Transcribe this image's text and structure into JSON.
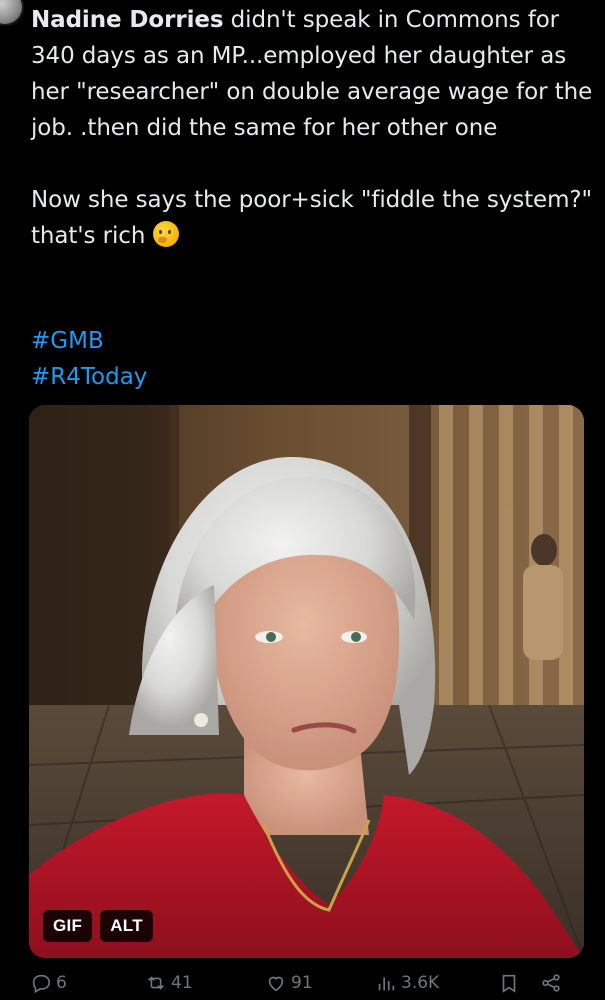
{
  "tweet": {
    "author": "Nadine Dorries",
    "para1_rest": " didn't speak in Commons for 340 days as an MP...employed her daughter as her \"researcher\" on double average wage for the job. .then did the same for her other one",
    "para2": "Now she says the poor+sick \"fiddle the system?\" that's rich",
    "emoji": "thinking-face-emoji",
    "hashtags": [
      "#GMB",
      "#R4Today"
    ]
  },
  "media": {
    "badges": [
      "GIF",
      "ALT"
    ]
  },
  "actions": {
    "replies": "6",
    "reposts": "41",
    "likes": "91",
    "views": "3.6K"
  },
  "colors": {
    "background": "#000000",
    "text": "#e7e9ea",
    "link": "#1d9bf0",
    "muted": "#71767b"
  }
}
